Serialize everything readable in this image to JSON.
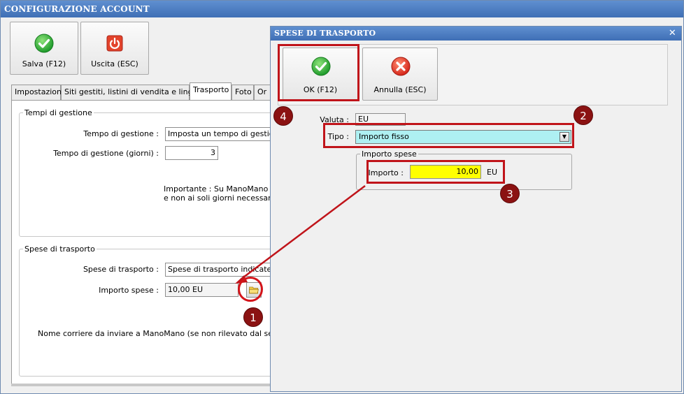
{
  "main": {
    "title": "CONFIGURAZIONE ACCOUNT",
    "toolbar": {
      "save_label": "Salva (F12)",
      "exit_label": "Uscita (ESC)"
    },
    "tabs": [
      {
        "label": "Impostazioni"
      },
      {
        "label": "Siti gestiti, listini di vendita e lingue"
      },
      {
        "label": "Trasporto"
      },
      {
        "label": "Foto"
      },
      {
        "label": "Or"
      }
    ],
    "tempi": {
      "title": "Tempi di gestione",
      "tempo_label": "Tempo di gestione :",
      "tempo_value": "Imposta un tempo di gestione f",
      "giorni_label": "Tempo di gestione (giorni) :",
      "giorni_value": "3",
      "note_line1": "Importante : Su ManoMano que",
      "note_line2": "e non ai soli giorni necessari per"
    },
    "spese": {
      "title": "Spese di trasporto",
      "spese_label": "Spese di trasporto :",
      "spese_value": "Spese di trasporto indicate sep",
      "importo_label": "Importo spese :",
      "importo_value": "10,00 EU",
      "corriere_note": "Nome corriere da inviare a ManoMano (se non rilevato dal set di spese"
    }
  },
  "dialog": {
    "title": "SPESE DI TRASPORTO",
    "ok_label": "OK (F12)",
    "cancel_label": "Annulla (ESC)",
    "valuta_label": "Valuta :",
    "valuta_value": "EU",
    "tipo_label": "Tipo :",
    "tipo_value": "Importo fisso",
    "group_title": "Importo spese",
    "importo_label": "Importo :",
    "importo_value": "10,00",
    "importo_unit": "EU"
  },
  "annotations": {
    "badge1": "1",
    "badge2": "2",
    "badge3": "3",
    "badge4": "4"
  },
  "colors": {
    "title_bar": "#3f6fb5",
    "annotation_red": "#c0141a",
    "badge": "#8b1212",
    "tipo_field": "#aef0f2",
    "importo_field": "#ffff00"
  },
  "icons": {
    "save": "check-icon",
    "exit": "power-icon",
    "ok": "check-icon",
    "cancel": "x-icon",
    "folder": "folder-icon"
  }
}
